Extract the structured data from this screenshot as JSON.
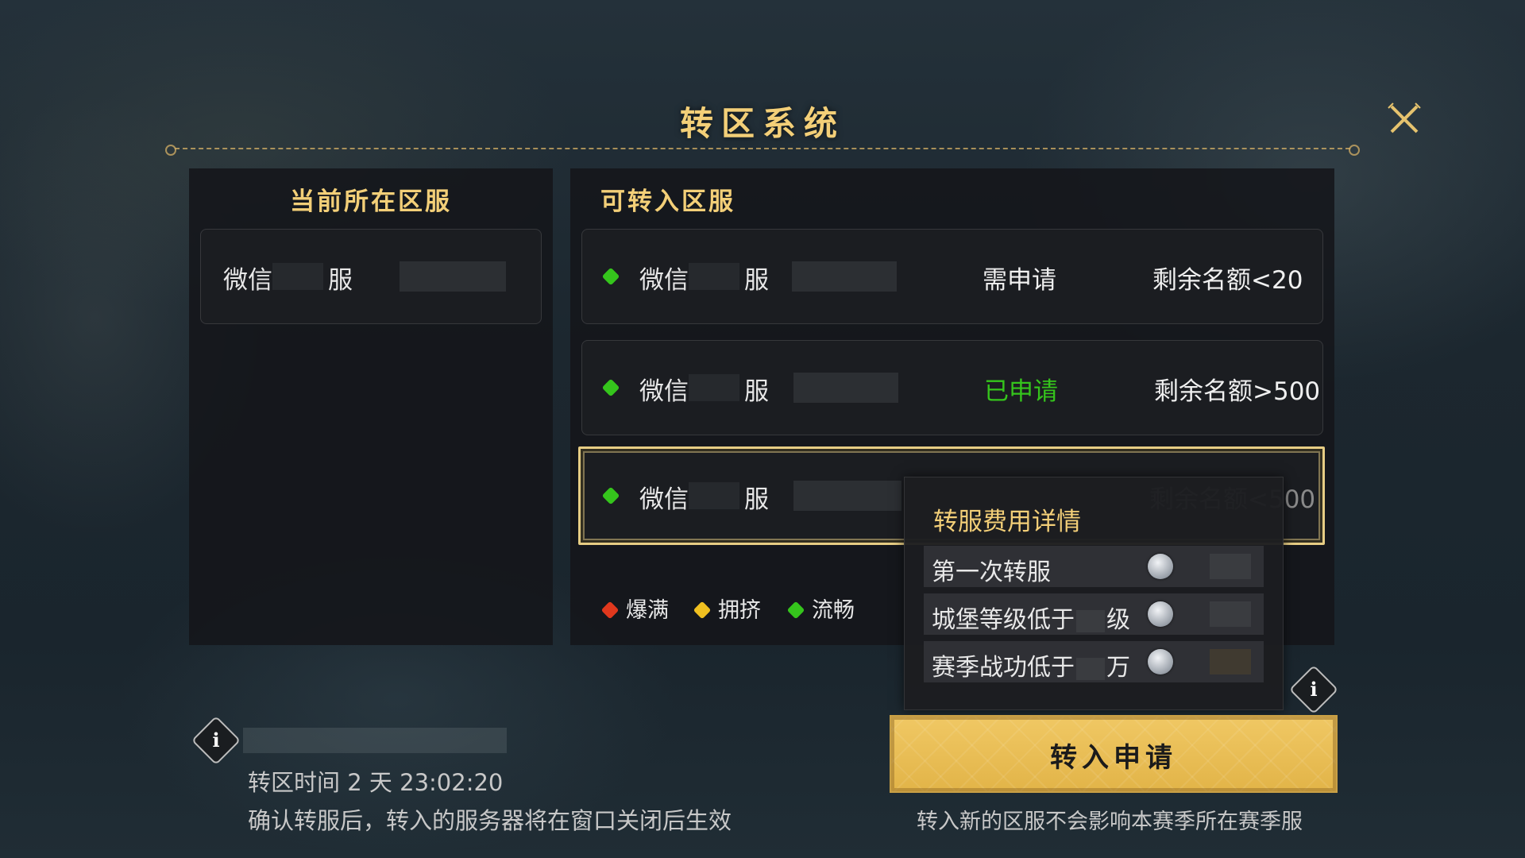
{
  "title": "转区系统",
  "left_panel": {
    "heading": "当前所在区服",
    "server": {
      "prefix": "微信",
      "suffix": "服"
    }
  },
  "right_panel": {
    "heading": "可转入区服",
    "servers": [
      {
        "prefix": "微信",
        "suffix": "服",
        "status": "需申请",
        "status_color": "#f0f0f0",
        "quota": "剩余名额<20",
        "load": "流畅"
      },
      {
        "prefix": "微信",
        "suffix": "服",
        "status": "已申请",
        "status_color": "#35c51c",
        "quota": "剩余名额>500",
        "load": "流畅"
      },
      {
        "prefix": "微信",
        "suffix": "服",
        "status": "",
        "quota": "剩余名额<500",
        "load": "流畅",
        "selected": true
      }
    ],
    "legend": [
      {
        "label": "爆满",
        "color": "#e0381d"
      },
      {
        "label": "拥挤",
        "color": "#f0c020"
      },
      {
        "label": "流畅",
        "color": "#35c51c"
      }
    ]
  },
  "fee_popup": {
    "title": "转服费用详情",
    "rows": [
      {
        "label": "第一次转服",
        "icon": "silver-coin-icon"
      },
      {
        "label_a": "城堡等级低于",
        "label_b": "级",
        "icon": "silver-coin-icon"
      },
      {
        "label_a": "赛季战功低于",
        "label_b": "万",
        "icon": "silver-coin-icon"
      }
    ]
  },
  "footer_left": {
    "transfer_time_label": "转区时间",
    "transfer_time_value": "2 天 23:02:20",
    "notice": "确认转服后，转入的服务器将在窗口关闭后生效"
  },
  "apply_button": "转入申请",
  "footer_right": "转入新的区服不会影响本赛季所在赛季服",
  "colors": {
    "gold": "#f3cf78",
    "button": "#e8bd55",
    "green": "#35c51c"
  }
}
